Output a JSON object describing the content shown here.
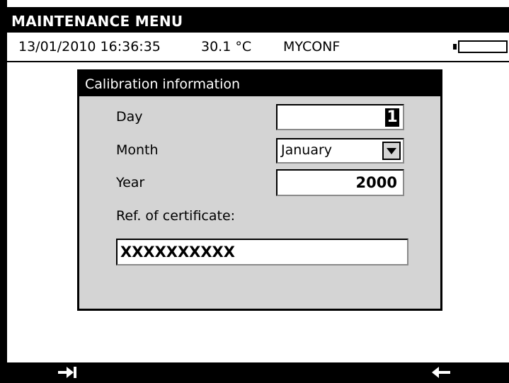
{
  "header": {
    "title": "MAINTENANCE MENU"
  },
  "status": {
    "datetime": "13/01/2010 16:36:35",
    "temperature": "30.1 °C",
    "config": "MYCONF",
    "battery_icon": "battery-icon",
    "battery_level": 0.0
  },
  "dialog": {
    "title": "Calibration information",
    "day_label": "Day",
    "day_value": "1",
    "month_label": "Month",
    "month_value": "January",
    "year_label": "Year",
    "year_value": "2000",
    "ref_label": "Ref. of certificate:",
    "ref_value": "XXXXXXXXXX"
  },
  "softkeys": {
    "left_icon": "tab-arrow-icon",
    "right_icon": "back-arrow-icon"
  },
  "colors": {
    "bar": "#000000",
    "dialog_bg": "#d4d4d4"
  }
}
